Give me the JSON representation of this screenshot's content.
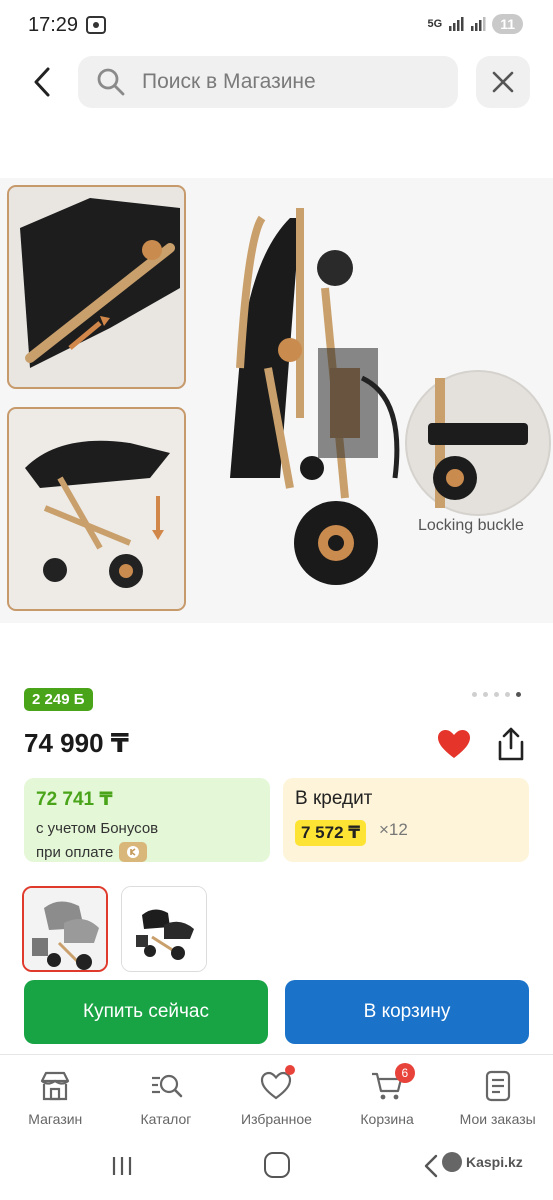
{
  "status_bar": {
    "time": "17:29",
    "network": "5G",
    "battery": "11"
  },
  "search": {
    "placeholder": "Поиск в Магазине"
  },
  "product": {
    "image_caption": "Locking buckle",
    "bonus": "2 249 Б",
    "price": "74 990 ₸",
    "pager": {
      "total": 5,
      "active": 5
    },
    "favorited": true,
    "bonus_card": {
      "amount": "72 741 ₸",
      "line1": "с учетом Бонусов",
      "line2": "при оплате"
    },
    "credit_card": {
      "label": "В кредит",
      "monthly": "7 572 ₸",
      "months": "×12"
    },
    "thumbnails": [
      {
        "name": "grey-stroller-set",
        "selected": true
      },
      {
        "name": "black-stroller-set",
        "selected": false
      }
    ]
  },
  "actions": {
    "buy_label": "Купить сейчас",
    "cart_label": "В корзину"
  },
  "nav": {
    "items": [
      {
        "label": "Магазин",
        "icon": "shop-icon"
      },
      {
        "label": "Каталог",
        "icon": "catalog-icon"
      },
      {
        "label": "Избранное",
        "icon": "heart-icon"
      },
      {
        "label": "Корзина",
        "icon": "cart-icon",
        "badge": "6"
      },
      {
        "label": "Мои заказы",
        "icon": "orders-icon"
      }
    ]
  },
  "watermark": "Kaspi.kz",
  "colors": {
    "green": "#18a345",
    "blue": "#1a72c9",
    "bonus_green": "#4aa41a",
    "heart_red": "#e5352b",
    "badge_red": "#e8433a",
    "credit_yellow": "#fde434"
  }
}
